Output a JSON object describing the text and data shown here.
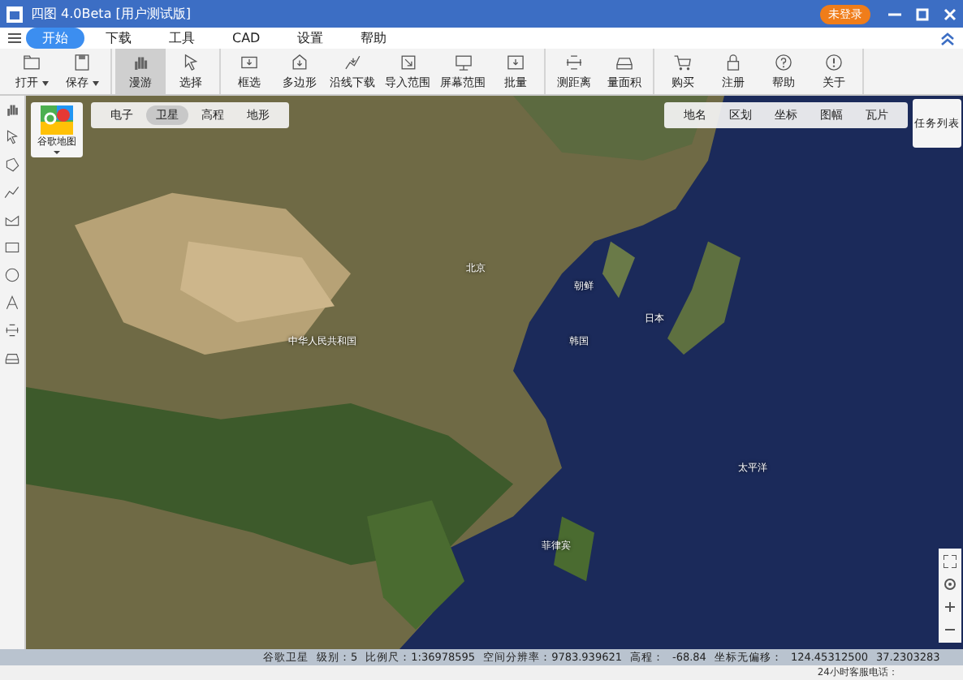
{
  "window": {
    "title": "四图 4.0Beta [用户测试版]",
    "login_badge": "未登录"
  },
  "menu": [
    {
      "label": "开始",
      "selected": true
    },
    {
      "label": "下载",
      "selected": false
    },
    {
      "label": "工具",
      "selected": false
    },
    {
      "label": "CAD",
      "selected": false
    },
    {
      "label": "设置",
      "selected": false
    },
    {
      "label": "帮助",
      "selected": false
    }
  ],
  "toolbar": {
    "groups": [
      [
        {
          "label": "打开",
          "dropdown": true,
          "selected": false
        },
        {
          "label": "保存",
          "dropdown": true,
          "selected": false
        }
      ],
      [
        {
          "label": "漫游",
          "dropdown": false,
          "selected": true
        },
        {
          "label": "选择",
          "dropdown": false,
          "selected": false
        }
      ],
      [
        {
          "label": "框选",
          "dropdown": false,
          "selected": false
        },
        {
          "label": "多边形",
          "dropdown": false,
          "selected": false
        },
        {
          "label": "沿线下载",
          "dropdown": false,
          "selected": false
        },
        {
          "label": "导入范围",
          "dropdown": false,
          "selected": false
        },
        {
          "label": "屏幕范围",
          "dropdown": false,
          "selected": false
        },
        {
          "label": "批量",
          "dropdown": false,
          "selected": false
        }
      ],
      [
        {
          "label": "测距离",
          "dropdown": false,
          "selected": false
        },
        {
          "label": "量面积",
          "dropdown": false,
          "selected": false
        }
      ],
      [
        {
          "label": "购买",
          "dropdown": false,
          "selected": false
        },
        {
          "label": "注册",
          "dropdown": false,
          "selected": false
        },
        {
          "label": "帮助",
          "dropdown": false,
          "selected": false
        },
        {
          "label": "关于",
          "dropdown": false,
          "selected": false
        }
      ]
    ]
  },
  "map": {
    "source": "谷歌地图",
    "map_types": [
      {
        "label": "电子",
        "selected": false
      },
      {
        "label": "卫星",
        "selected": true
      },
      {
        "label": "高程",
        "selected": false
      },
      {
        "label": "地形",
        "selected": false
      }
    ],
    "layers": [
      {
        "label": "地名"
      },
      {
        "label": "区划"
      },
      {
        "label": "坐标"
      },
      {
        "label": "图幅"
      },
      {
        "label": "瓦片"
      }
    ],
    "task_list_button": "任务列表",
    "places": [
      "北京",
      "朝鲜",
      "韩国",
      "日本",
      "中华人民共和国",
      "太平洋",
      "菲律宾"
    ]
  },
  "status_bar": [
    "谷歌卫星",
    "级别：5",
    "比例尺：1:36978595",
    "空间分辨率：9783.939621",
    "高程：",
    "-68.84",
    "坐标无偏移：",
    "124.45312500",
    "37.2303283"
  ],
  "footer": "24小时客服电话："
}
